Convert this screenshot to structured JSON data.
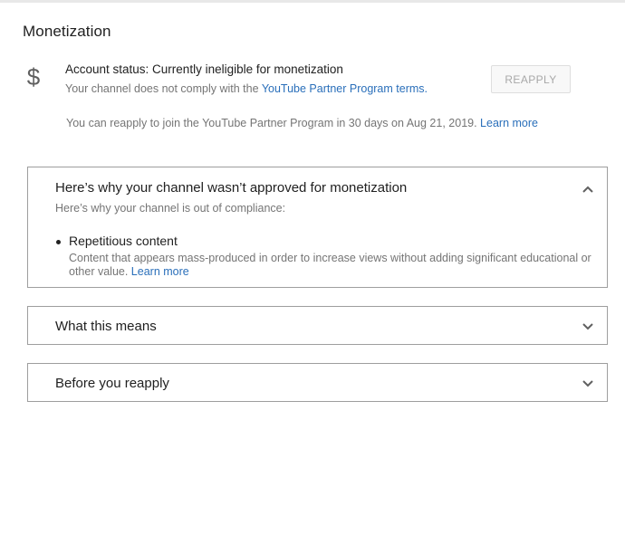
{
  "page": {
    "title": "Monetization"
  },
  "account_status": {
    "icon": "dollar-icon",
    "icon_glyph": "$",
    "title": "Account status: Currently ineligible for monetization",
    "desc_prefix": "Your channel does not comply with the ",
    "desc_link": "YouTube Partner Program terms.",
    "reapply_button": "REAPPLY",
    "reapply_note": "You can reapply to join the YouTube Partner Program in 30 days on Aug 21, 2019. ",
    "reapply_note_link": "Learn more"
  },
  "panels": [
    {
      "title": "Here’s why your channel wasn’t approved for monetization",
      "subtitle": "Here’s why your channel is out of compliance:",
      "expanded": true,
      "reasons": [
        {
          "title": "Repetitious content",
          "desc": "Content that appears mass-produced in order to increase views without adding significant educational or other value.  ",
          "link": "Learn more"
        }
      ]
    },
    {
      "title": "What this means",
      "expanded": false
    },
    {
      "title": "Before you reapply",
      "expanded": false
    }
  ],
  "colors": {
    "link": "#2a6fba",
    "muted_text": "#757575",
    "panel_border": "#9e9e9e"
  }
}
